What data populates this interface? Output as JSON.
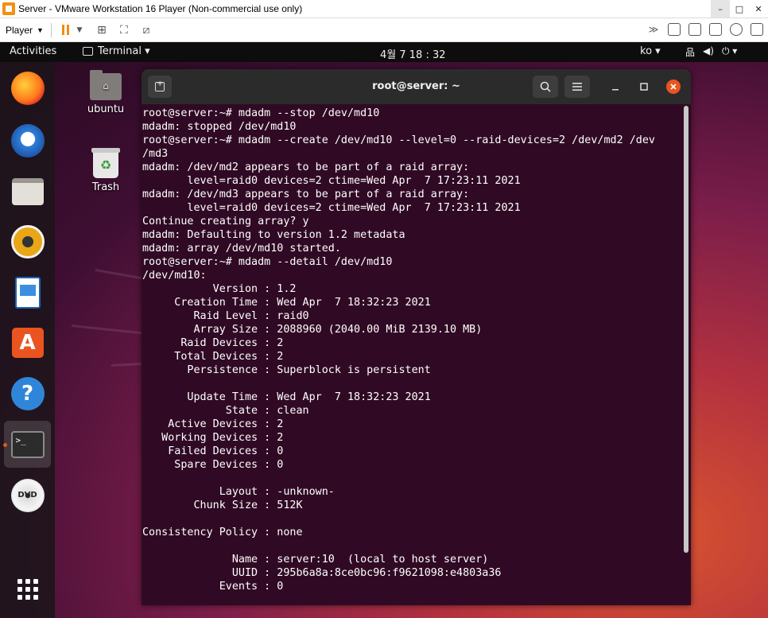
{
  "vmware": {
    "title": "Server - VMware Workstation 16 Player (Non-commercial use only)",
    "player_label": "Player",
    "win_minimize": "–",
    "win_maximize": "□",
    "win_close": "✕"
  },
  "topbar": {
    "activities": "Activities",
    "terminal_menu": "Terminal ▾",
    "clock": "4월 7 18 : 32",
    "lang": "ko ▾",
    "sys_network": "品",
    "sys_volume": "◀)",
    "sys_power": "⏻ ▾"
  },
  "desktop": {
    "icons": [
      {
        "label": "ubuntu"
      },
      {
        "label": "Trash"
      }
    ]
  },
  "dock": {
    "items": [
      "firefox-icon",
      "thunderbird-icon",
      "files-icon",
      "rhythmbox-icon",
      "writer-icon",
      "software-icon",
      "help-icon",
      "terminal-icon",
      "dvd-icon",
      "show-apps-icon"
    ]
  },
  "terminal": {
    "title": "root@server: ~",
    "lines": [
      "root@server:~# mdadm --stop /dev/md10",
      "mdadm: stopped /dev/md10",
      "root@server:~# mdadm --create /dev/md10 --level=0 --raid-devices=2 /dev/md2 /dev",
      "/md3",
      "mdadm: /dev/md2 appears to be part of a raid array:",
      "       level=raid0 devices=2 ctime=Wed Apr  7 17:23:11 2021",
      "mdadm: /dev/md3 appears to be part of a raid array:",
      "       level=raid0 devices=2 ctime=Wed Apr  7 17:23:11 2021",
      "Continue creating array? y",
      "mdadm: Defaulting to version 1.2 metadata",
      "mdadm: array /dev/md10 started.",
      "root@server:~# mdadm --detail /dev/md10",
      "/dev/md10:",
      "           Version : 1.2",
      "     Creation Time : Wed Apr  7 18:32:23 2021",
      "        Raid Level : raid0",
      "        Array Size : 2088960 (2040.00 MiB 2139.10 MB)",
      "      Raid Devices : 2",
      "     Total Devices : 2",
      "       Persistence : Superblock is persistent",
      "",
      "       Update Time : Wed Apr  7 18:32:23 2021",
      "             State : clean",
      "    Active Devices : 2",
      "   Working Devices : 2",
      "    Failed Devices : 0",
      "     Spare Devices : 0",
      "",
      "            Layout : -unknown-",
      "        Chunk Size : 512K",
      "",
      "Consistency Policy : none",
      "",
      "              Name : server:10  (local to host server)",
      "              UUID : 295b6a8a:8ce0bc96:f9621098:e4803a36",
      "            Events : 0"
    ]
  },
  "colors": {
    "terminal_bg": "#300a24",
    "accent": "#e95420",
    "headerbar": "#2b2b2b"
  }
}
